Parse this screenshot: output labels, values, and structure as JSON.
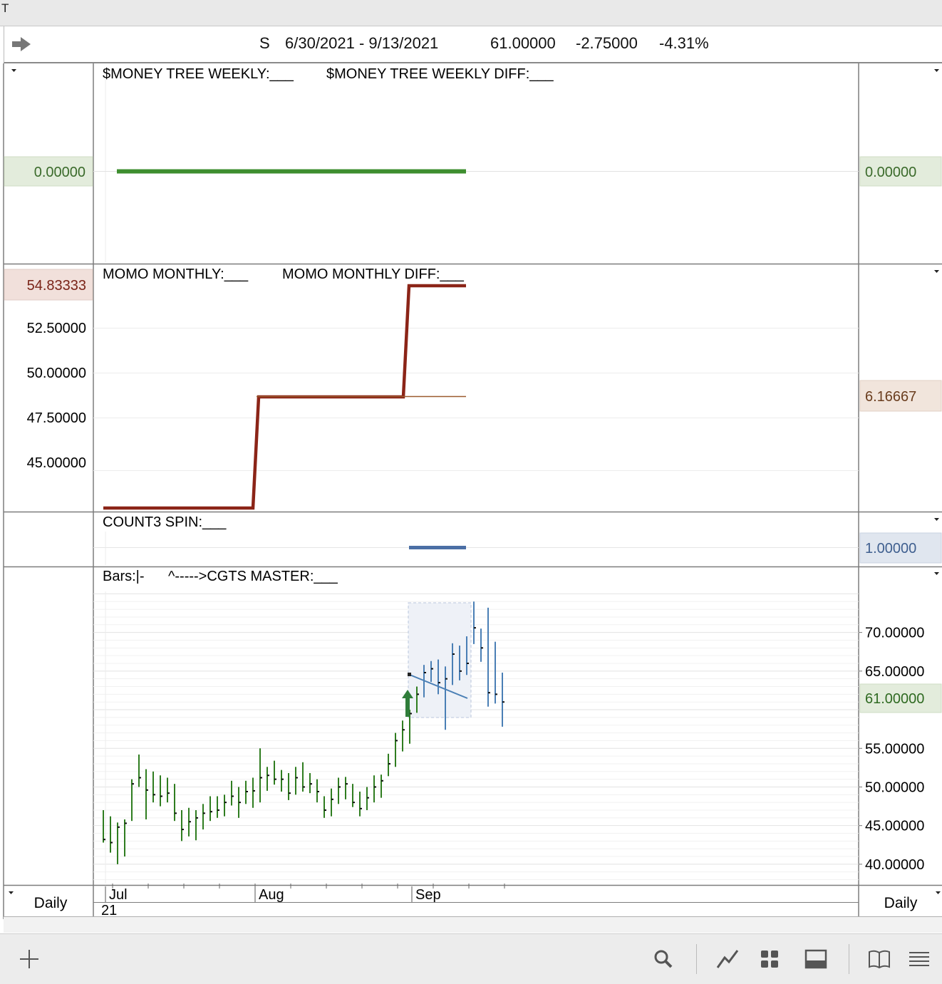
{
  "window": {
    "title": "T"
  },
  "header": {
    "symbol": "S",
    "date_range": "6/30/2021 - 9/13/2021",
    "last": "61.00000",
    "change": "-2.75000",
    "change_pct": "-4.31%"
  },
  "footer": {
    "left_period": "Daily",
    "right_period": "Daily",
    "year_label": "21"
  },
  "colors": {
    "green": "#3e8e2f",
    "darkred": "#8b2417",
    "brown": "#9a5a2e",
    "blue": "#4b6fa5",
    "steelblue": "#4a7fb5",
    "barGreen": "#2f7d20"
  },
  "chart_data": [
    {
      "name": "money_tree_panel",
      "type": "line",
      "legend": [
        "$MONEY TREE WEEKLY:___",
        "$MONEY TREE WEEKLY DIFF:___"
      ],
      "series": [
        {
          "name": "$MONEY TREE WEEKLY",
          "x": [
            "2021-07-01",
            "2021-09-13"
          ],
          "values": [
            0,
            0
          ]
        }
      ],
      "left_value_label": "0.00000",
      "right_value_label": "0.00000"
    },
    {
      "name": "momo_panel",
      "type": "line",
      "legend": [
        "MOMO MONTHLY:___",
        "MOMO MONTHLY DIFF:___"
      ],
      "yticks": [
        "52.50000",
        "50.00000",
        "47.50000",
        "45.00000"
      ],
      "ylim": [
        42.4,
        55.6
      ],
      "series": [
        {
          "name": "MOMO MONTHLY",
          "x": [
            "2021-06-30",
            "2021-07-30",
            "2021-08-01",
            "2021-08-30",
            "2021-09-01",
            "2021-09-13"
          ],
          "values": [
            42.9,
            42.9,
            48.8,
            48.8,
            54.83333,
            54.83333
          ]
        },
        {
          "name": "MOMO MONTHLY DIFF",
          "x": [
            "2021-08-01",
            "2021-09-13"
          ],
          "values": [
            6.16667,
            6.16667
          ]
        }
      ],
      "left_value_label": "54.83333",
      "right_value_label": "6.16667"
    },
    {
      "name": "count3_panel",
      "type": "line",
      "legend": [
        "COUNT3 SPIN:___"
      ],
      "series": [
        {
          "name": "COUNT3 SPIN",
          "x": [
            "2021-09-01",
            "2021-09-13"
          ],
          "values": [
            1,
            1
          ]
        }
      ],
      "right_value_label": "1.00000"
    },
    {
      "name": "price_panel",
      "type": "bar",
      "legend": [
        "Bars:|-",
        "^----->CGTS MASTER:___"
      ],
      "yticks": [
        "70.00000",
        "65.00000",
        "55.00000",
        "50.00000",
        "45.00000",
        "40.00000"
      ],
      "ylim": [
        37.5,
        75.5
      ],
      "last_price_label": "61.00000",
      "xticks": [
        "Jul",
        "Aug",
        "Sep"
      ],
      "ohlc": [
        {
          "date": "2021-06-30",
          "high": 47.0,
          "low": 42.8,
          "close": 43.2
        },
        {
          "date": "2021-07-01",
          "high": 46.2,
          "low": 41.5,
          "close": 42.8
        },
        {
          "date": "2021-07-02",
          "high": 45.4,
          "low": 40.0,
          "close": 44.8
        },
        {
          "date": "2021-07-06",
          "high": 45.8,
          "low": 41.0,
          "close": 45.3
        },
        {
          "date": "2021-07-07",
          "high": 51.0,
          "low": 45.6,
          "close": 50.4
        },
        {
          "date": "2021-07-08",
          "high": 54.2,
          "low": 50.0,
          "close": 51.2
        },
        {
          "date": "2021-07-09",
          "high": 52.3,
          "low": 45.8,
          "close": 49.6
        },
        {
          "date": "2021-07-12",
          "high": 52.0,
          "low": 48.0,
          "close": 49.0
        },
        {
          "date": "2021-07-13",
          "high": 51.5,
          "low": 47.5,
          "close": 48.8
        },
        {
          "date": "2021-07-14",
          "high": 51.2,
          "low": 48.0,
          "close": 49.2
        },
        {
          "date": "2021-07-15",
          "high": 50.4,
          "low": 45.6,
          "close": 46.6
        },
        {
          "date": "2021-07-16",
          "high": 47.0,
          "low": 43.0,
          "close": 44.5
        },
        {
          "date": "2021-07-19",
          "high": 47.3,
          "low": 43.6,
          "close": 45.5
        },
        {
          "date": "2021-07-20",
          "high": 47.0,
          "low": 43.1,
          "close": 46.0
        },
        {
          "date": "2021-07-21",
          "high": 47.8,
          "low": 44.5,
          "close": 46.6
        },
        {
          "date": "2021-07-22",
          "high": 48.8,
          "low": 45.6,
          "close": 46.8
        },
        {
          "date": "2021-07-23",
          "high": 48.8,
          "low": 46.0,
          "close": 47.0
        },
        {
          "date": "2021-07-26",
          "high": 49.0,
          "low": 46.2,
          "close": 48.0
        },
        {
          "date": "2021-07-27",
          "high": 50.8,
          "low": 47.6,
          "close": 48.8
        },
        {
          "date": "2021-07-28",
          "high": 50.0,
          "low": 46.0,
          "close": 48.0
        },
        {
          "date": "2021-07-29",
          "high": 50.8,
          "low": 47.8,
          "close": 49.4
        },
        {
          "date": "2021-07-30",
          "high": 51.2,
          "low": 47.3,
          "close": 49.5
        },
        {
          "date": "2021-08-02",
          "high": 55.0,
          "low": 48.0,
          "close": 51.2
        },
        {
          "date": "2021-08-03",
          "high": 52.6,
          "low": 49.5,
          "close": 51.5
        },
        {
          "date": "2021-08-04",
          "high": 53.4,
          "low": 50.3,
          "close": 51.0
        },
        {
          "date": "2021-08-05",
          "high": 52.2,
          "low": 49.4,
          "close": 51.0
        },
        {
          "date": "2021-08-06",
          "high": 51.8,
          "low": 48.3,
          "close": 49.2
        },
        {
          "date": "2021-08-09",
          "high": 52.6,
          "low": 49.0,
          "close": 51.2
        },
        {
          "date": "2021-08-10",
          "high": 53.2,
          "low": 49.4,
          "close": 50.0
        },
        {
          "date": "2021-08-11",
          "high": 51.8,
          "low": 49.2,
          "close": 50.4
        },
        {
          "date": "2021-08-12",
          "high": 51.0,
          "low": 48.0,
          "close": 49.4
        },
        {
          "date": "2021-08-13",
          "high": 48.8,
          "low": 46.0,
          "close": 47.0
        },
        {
          "date": "2021-08-16",
          "high": 49.8,
          "low": 46.2,
          "close": 48.4
        },
        {
          "date": "2021-08-17",
          "high": 51.2,
          "low": 47.8,
          "close": 50.0
        },
        {
          "date": "2021-08-18",
          "high": 51.3,
          "low": 48.4,
          "close": 50.4
        },
        {
          "date": "2021-08-19",
          "high": 50.4,
          "low": 47.4,
          "close": 48.0
        },
        {
          "date": "2021-08-20",
          "high": 49.4,
          "low": 46.2,
          "close": 47.2
        },
        {
          "date": "2021-08-23",
          "high": 50.0,
          "low": 47.0,
          "close": 48.6
        },
        {
          "date": "2021-08-24",
          "high": 51.5,
          "low": 48.0,
          "close": 50.0
        },
        {
          "date": "2021-08-25",
          "high": 51.6,
          "low": 48.6,
          "close": 50.8
        },
        {
          "date": "2021-08-26",
          "high": 54.3,
          "low": 51.4,
          "close": 53.0
        },
        {
          "date": "2021-08-27",
          "high": 57.0,
          "low": 52.6,
          "close": 56.0
        },
        {
          "date": "2021-08-30",
          "high": 58.6,
          "low": 54.6,
          "close": 57.4
        },
        {
          "date": "2021-08-31",
          "high": 60.0,
          "low": 55.6,
          "close": 59.5
        },
        {
          "date": "2021-09-01",
          "high": 63.0,
          "low": 59.6,
          "close": 62.0
        },
        {
          "date": "2021-09-02",
          "high": 65.8,
          "low": 61.6,
          "close": 64.8
        },
        {
          "date": "2021-09-03",
          "high": 66.3,
          "low": 63.6,
          "close": 65.3
        },
        {
          "date": "2021-09-06",
          "high": 66.5,
          "low": 62.0,
          "close": 63.5
        },
        {
          "date": "2021-09-07",
          "high": 65.6,
          "low": 57.4,
          "close": 64.0
        },
        {
          "date": "2021-09-08",
          "high": 68.6,
          "low": 63.2,
          "close": 67.2
        },
        {
          "date": "2021-09-09",
          "high": 68.3,
          "low": 63.8,
          "close": 65.0
        },
        {
          "date": "2021-09-10",
          "high": 69.5,
          "low": 64.5,
          "close": 66.0
        },
        {
          "date": "2021-09-13",
          "high": 74.0,
          "low": 68.5,
          "close": 70.6
        },
        {
          "date": "2021-09-14",
          "high": 70.5,
          "low": 66.2,
          "close": 68.0
        },
        {
          "date": "2021-09-15",
          "high": 73.2,
          "low": 60.4,
          "close": 62.2
        },
        {
          "date": "2021-09-16",
          "high": 68.8,
          "low": 60.8,
          "close": 62.0
        },
        {
          "date": "2021-09-17",
          "high": 64.8,
          "low": 57.8,
          "close": 61.0
        }
      ]
    }
  ]
}
